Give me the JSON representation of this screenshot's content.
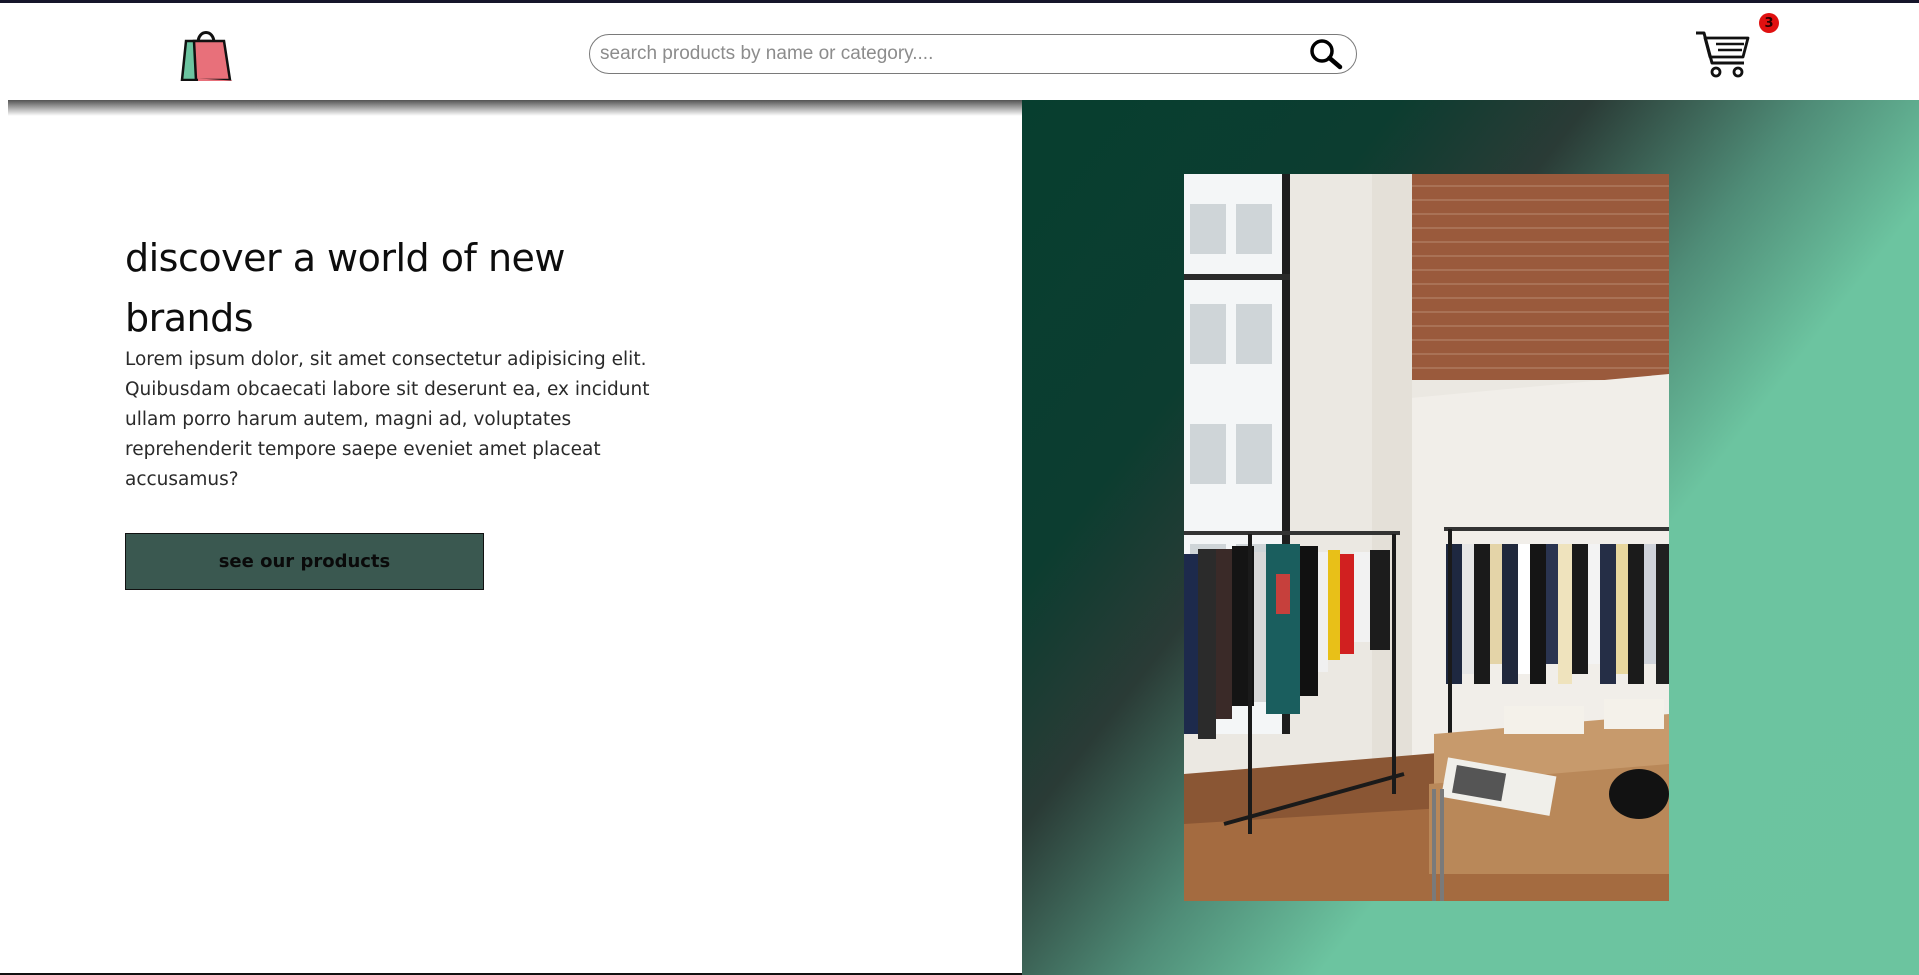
{
  "header": {
    "logo_icon": "shopping-bag-icon",
    "search": {
      "placeholder": "search products by name or category....",
      "value": "",
      "button_icon": "search-icon"
    },
    "cart": {
      "icon": "cart-icon",
      "count": "3",
      "badge_color": "#e01010"
    }
  },
  "hero": {
    "title": "discover a world of new brands",
    "description": "Lorem ipsum dolor, sit amet consectetur adipisicing elit. Quibusdam obcaecati labore sit deserunt ea, ex incidunt ullam porro harum autem, magni ad, voluptates reprehenderit tempore saepe eveniet amet placeat accusamus?",
    "cta_label": "see our products",
    "cta_color": "#3a5850"
  },
  "showcase": {
    "image_icon": "clothing-store-photo",
    "gradient_dark": "#073e2f",
    "gradient_light": "#6cc4a0"
  }
}
